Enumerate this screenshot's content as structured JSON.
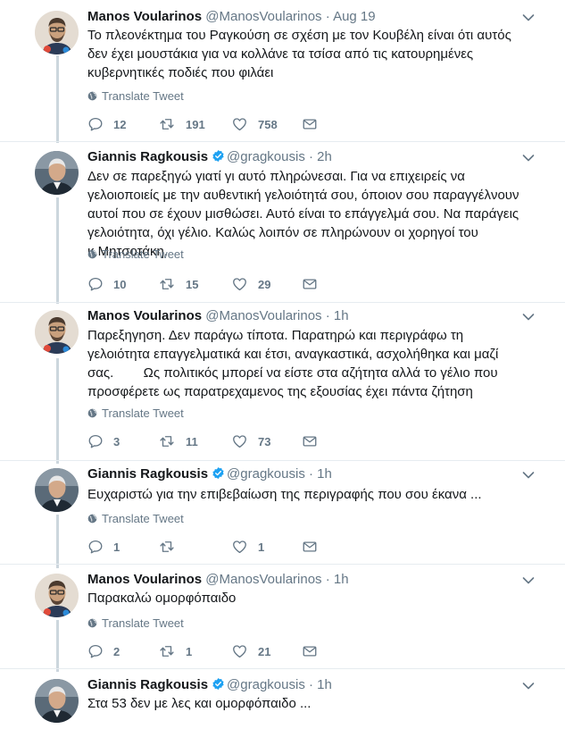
{
  "tweets": [
    {
      "author": "Manos Voularinos",
      "handle": "@ManosVoularinos",
      "separator": "·",
      "time": "Aug 19",
      "verified": false,
      "text": "Το πλεονέκτημα του Ραγκούση σε σχέση με τον Κουβέλη είναι ότι αυτός δεν έχει μουστάκια για να κολλάνε τα τσίσα από τις κατουρημένες κυβερνητικές ποδιές που φιλάει",
      "translate": "Translate Tweet",
      "replies": "12",
      "retweets": "191",
      "likes": "758"
    },
    {
      "author": "Giannis Ragkousis",
      "handle": "@gragkousis",
      "separator": "·",
      "time": "2h",
      "verified": true,
      "text": "Δεν σε παρεξηγώ γιατί γι αυτό πληρώνεσαι. Για να επιχειρείς να γελοιοποιείς με την αυθεντική γελοιότητά σου, όποιον σου παραγγέλνουν αυτοί που σε έχουν μισθώσει. Αυτό είναι το επάγγελμά σου. Να παράγεις γελοιότητα, όχι γέλιο. Καλώς λοιπόν σε πληρώνουν οι χορηγοί του κ.Μητσοτάκη.",
      "translate": "Translate Tweet",
      "replies": "10",
      "retweets": "15",
      "likes": "29"
    },
    {
      "author": "Manos Voularinos",
      "handle": "@ManosVoularinos",
      "separator": "·",
      "time": "1h",
      "verified": false,
      "text": "Παρεξηγηση. Δεν παράγω τίποτα. Παρατηρώ και περιγράφω τη γελοιότητα επαγγελματικά και έτσι, αναγκαστικά, ασχολήθηκα και μαζί σας.        Ως πολιτικός μπορεί να είστε στα αζήτητα αλλά το γέλιο που προσφέρετε ως παρατρεχαμενος της εξουσίας έχει πάντα ζήτηση",
      "translate": "Translate Tweet",
      "replies": "3",
      "retweets": "11",
      "likes": "73"
    },
    {
      "author": "Giannis Ragkousis",
      "handle": "@gragkousis",
      "separator": "·",
      "time": "1h",
      "verified": true,
      "text": "Ευχαριστώ για την επιβεβαίωση της περιγραφής που σου έκανα ...",
      "translate": "Translate Tweet",
      "replies": "1",
      "retweets": "",
      "likes": "1"
    },
    {
      "author": "Manos Voularinos",
      "handle": "@ManosVoularinos",
      "separator": "·",
      "time": "1h",
      "verified": false,
      "text": "Παρακαλώ ομορφόπαιδο",
      "translate": "Translate Tweet",
      "replies": "2",
      "retweets": "1",
      "likes": "21"
    },
    {
      "author": "Giannis Ragkousis",
      "handle": "@gragkousis",
      "separator": "·",
      "time": "1h",
      "verified": true,
      "text": "Στα 53 δεν με λες και ομορφόπαιδο ...",
      "translate": "",
      "replies": "",
      "retweets": "",
      "likes": ""
    }
  ],
  "icons": {
    "reply": "reply-icon",
    "retweet": "retweet-icon",
    "like": "heart-icon",
    "dm": "envelope-icon",
    "globe": "globe-icon",
    "verified": "verified-badge-icon",
    "caret": "chevron-down-icon"
  },
  "colors": {
    "text": "#14171a",
    "secondary": "#657786",
    "verified": "#1da1f2",
    "thread_line": "#ccd6dd",
    "divider": "#e6ecf0"
  }
}
